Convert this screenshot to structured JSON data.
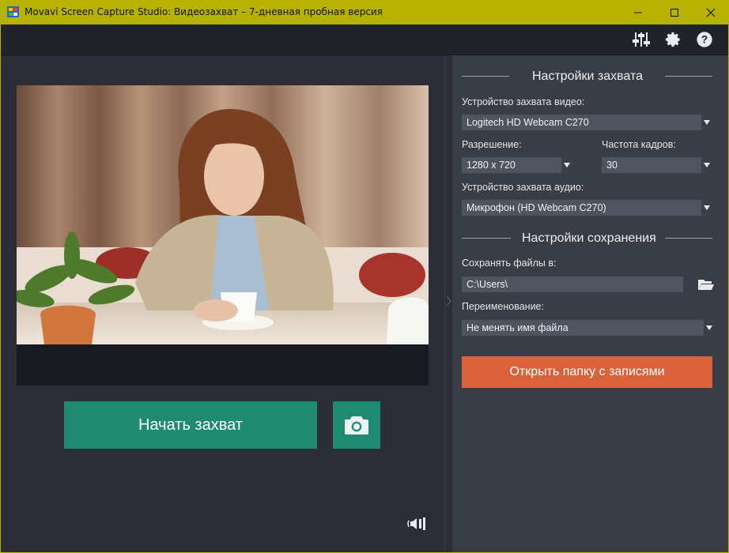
{
  "window": {
    "title": "Movavi Screen Capture Studio: Видеозахват – 7-дневная пробная версия",
    "controls": [
      "minimize-icon",
      "maximize-icon",
      "close-icon"
    ]
  },
  "toolbar": {
    "icons": [
      "sliders-icon",
      "gear-icon",
      "help-icon"
    ]
  },
  "preview": {
    "image": "webcam-preview-photo"
  },
  "actions": {
    "start_capture": "Начать захват",
    "snapshot_icon": "camera-icon",
    "audio_icon": "speaker-icon"
  },
  "capture_settings": {
    "title": "Настройки захвата",
    "video_device_label": "Устройство захвата видео:",
    "video_device_value": "Logitech HD Webcam C270",
    "resolution_label": "Разрешение:",
    "resolution_value": "1280 x 720",
    "fps_label": "Частота кадров:",
    "fps_value": "30",
    "audio_device_label": "Устройство захвата аудио:",
    "audio_device_value": "Микрофон (HD Webcam C270)"
  },
  "save_settings": {
    "title": "Настройки сохранения",
    "save_to_label": "Сохранять файлы в:",
    "save_to_value": "C:\\Users\\",
    "rename_label": "Переименование:",
    "rename_value": "Не менять имя файла",
    "open_folder_button": "Открыть папку с записями"
  },
  "colors": {
    "titlebar": "#b7b202",
    "accent_green": "#1f8a72",
    "accent_orange": "#d9623c"
  }
}
